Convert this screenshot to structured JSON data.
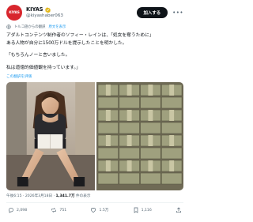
{
  "header": {
    "avatar_text": "KIYAS",
    "display_name": "KIYAS",
    "handle": "@kiyashaber063",
    "follow_label": "加入する",
    "more_icon": "more-icon"
  },
  "translation": {
    "label": "トルコ語からの翻訳",
    "link": "原文を表示"
  },
  "body": {
    "lines": [
      "アダルトコンテンツ制作者のソフィー・レインは、「処女を奪うために」",
      "ある人物が自分に1500万ドルを提示したことを明かした。",
      "",
      "「もちろんノーと言いました。",
      "",
      "私は道徳的価値観を持っています。」"
    ],
    "rate_link": "この翻訳を評価"
  },
  "timestamp": {
    "time": "午後6:15 · 2026年3月18日 · ",
    "views": "1,341.7万",
    "views_suffix": " 件の表示"
  },
  "actions": {
    "reply_count": "2,098",
    "repost_count": "751",
    "like_count": "1.5万",
    "bookmark_count": "1,116"
  },
  "colors": {
    "avatar_red": "#d8262d",
    "link_blue": "#1d9bf0",
    "verified_gold": "#e2b719",
    "secondary_text": "#536471"
  }
}
